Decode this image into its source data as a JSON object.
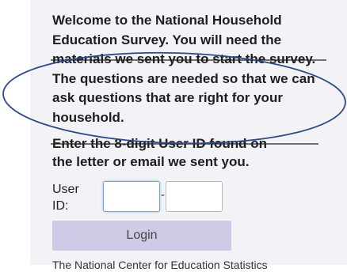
{
  "welcome_text": "Welcome to the National Household Education Survey. You will need the materials we sent you to start the survey. The questions are needed so that we can ask questions that are right for your household.",
  "instruction_text": "Enter the 8-digit User ID found on the letter or email we sent you.",
  "user_id": {
    "label": "User ID:",
    "separator": "-",
    "first_value": "",
    "second_value": ""
  },
  "login_button": "Login",
  "footer_partial": "The National Center for Education Statistics",
  "colors": {
    "panel_background": "#f3f3f7",
    "login_button_bg": "#cdcbe6",
    "focus_border": "#6aa6e6",
    "annotation_ellipse": "#2e4a86",
    "strike_line": "#222222"
  }
}
